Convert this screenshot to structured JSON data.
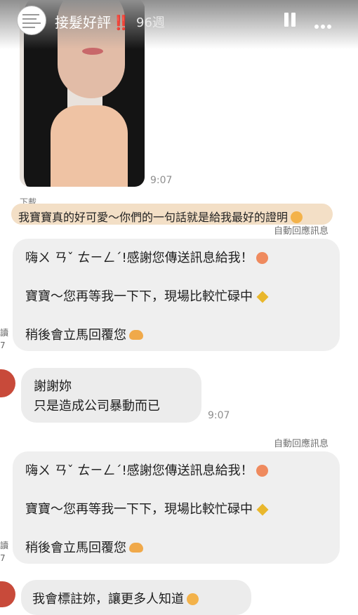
{
  "header": {
    "account_name": "接髮好評",
    "badge": "‼️",
    "age": "96週"
  },
  "chat": {
    "photo_time": "9:07",
    "download_label": "下載",
    "highlight_text": "我寶寶真的好可愛～你們的一句話就是給我最好的證明",
    "auto_reply_label": "自動回應訊息",
    "auto_reply_line1": "嗨ㄨ ㄢˇ ㄊㄧㄥˊ!感謝您傳送訊息給我！",
    "auto_reply_line2": "寶寶～您再等我一下下，現場比較忙碌中",
    "auto_reply_line3": "稍後會立馬回覆您",
    "thanks_line1": "謝謝妳",
    "thanks_line2": "只是造成公司暴動而已",
    "thanks_time": "9:07",
    "auto_reply_label_2": "自動回應訊息",
    "auto_reply2_line1": "嗨ㄨ ㄢˇ ㄊㄧㄥˊ!感謝您傳送訊息給我！",
    "auto_reply2_line2": "寶寶～您再等我一下下，現場比較忙碌中",
    "auto_reply2_line3": "稍後會立馬回覆您",
    "tag_message": "我會標註妳，讓更多人知道",
    "edge_text_1": "讀",
    "edge_text_1b": "7",
    "edge_text_2": "讀",
    "edge_text_2b": "7"
  },
  "icons": {
    "menu": "more-icon",
    "pause": "pause-icon",
    "like": "heart-icon",
    "share": "send-icon"
  }
}
